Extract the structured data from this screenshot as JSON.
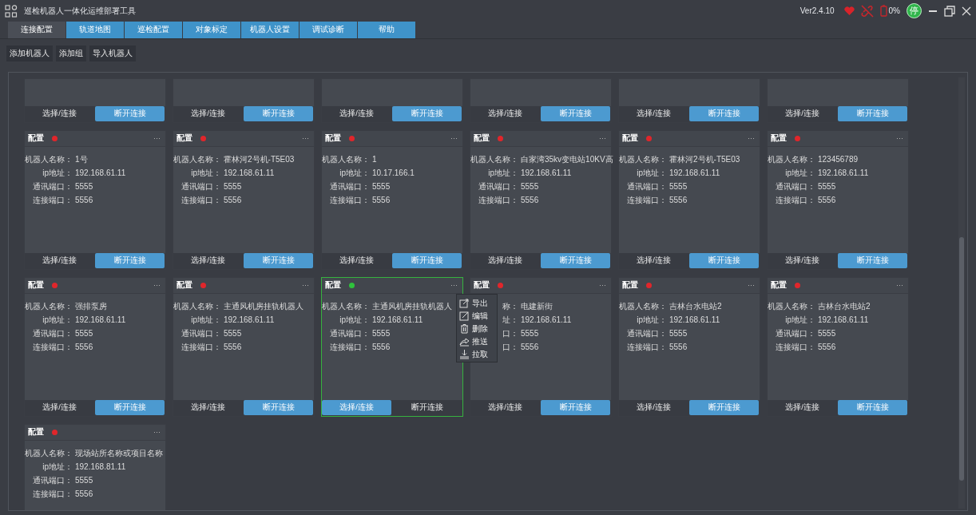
{
  "window": {
    "title": "巡检机器人一体化运维部署工具",
    "version": "Ver2.4.10",
    "battery": "0%",
    "run_state": "停"
  },
  "tabs": [
    {
      "label": "连接配置",
      "selected": true
    },
    {
      "label": "轨道地图",
      "selected": false
    },
    {
      "label": "巡检配置",
      "selected": false
    },
    {
      "label": "对象标定",
      "selected": false
    },
    {
      "label": "机器人设置",
      "selected": false
    },
    {
      "label": "调试诊断",
      "selected": false
    },
    {
      "label": "帮助",
      "selected": false
    }
  ],
  "toolbar": [
    "添加机器人",
    "添加组",
    "导入机器人"
  ],
  "cards": [
    {
      "buttons": [
        "选择/连接",
        "断开连接"
      ],
      "selected": false
    },
    {
      "buttons": [
        "选择/连接",
        "断开连接"
      ],
      "selected": false
    },
    {
      "buttons": [
        "选择/连接",
        "断开连接"
      ],
      "selected": false
    },
    {
      "buttons": [
        "选择/连接",
        "断开连接"
      ],
      "selected": false
    },
    {
      "buttons": [
        "选择/连接",
        "断开连接"
      ],
      "selected": false
    },
    {
      "buttons": [
        "选择/连接",
        "断开连接"
      ],
      "selected": false
    },
    {
      "title": "配置",
      "color": "#e0262b",
      "more": "···",
      "fields": [
        {
          "label": "机器人名称：",
          "value": "1号"
        },
        {
          "label": "ip地址：",
          "value": "192.168.61.11"
        },
        {
          "label": "通讯端口：",
          "value": "5555"
        },
        {
          "label": "连接端口：",
          "value": "5556"
        }
      ],
      "buttons": [
        "选择/连接",
        "断开连接"
      ],
      "selected": false
    },
    {
      "title": "配置",
      "color": "#e0262b",
      "more": "···",
      "fields": [
        {
          "label": "机器人名称：",
          "value": "霍林河2号机-T5E03"
        },
        {
          "label": "ip地址：",
          "value": "192.168.61.11"
        },
        {
          "label": "通讯端口：",
          "value": "5555"
        },
        {
          "label": "连接端口：",
          "value": "5556"
        }
      ],
      "buttons": [
        "选择/连接",
        "断开连接"
      ],
      "selected": false
    },
    {
      "title": "配置",
      "color": "#e0262b",
      "more": "···",
      "fields": [
        {
          "label": "机器人名称：",
          "value": "1"
        },
        {
          "label": "ip地址：",
          "value": "10.17.166.1"
        },
        {
          "label": "通讯端口：",
          "value": "5555"
        },
        {
          "label": "连接端口：",
          "value": "5556"
        }
      ],
      "buttons": [
        "选择/连接",
        "断开连接"
      ],
      "selected": false
    },
    {
      "title": "配置",
      "color": "#e0262b",
      "more": "···",
      "fields": [
        {
          "label": "机器人名称：",
          "value": "白家湾35kv变电站10KV高"
        },
        {
          "label": "ip地址：",
          "value": "192.168.61.11"
        },
        {
          "label": "通讯端口：",
          "value": "5555"
        },
        {
          "label": "连接端口：",
          "value": "5556"
        }
      ],
      "buttons": [
        "选择/连接",
        "断开连接"
      ],
      "selected": false
    },
    {
      "title": "配置",
      "color": "#e0262b",
      "more": "···",
      "fields": [
        {
          "label": "机器人名称：",
          "value": "霍林河2号机-T5E03"
        },
        {
          "label": "ip地址：",
          "value": "192.168.61.11"
        },
        {
          "label": "通讯端口：",
          "value": "5555"
        },
        {
          "label": "连接端口：",
          "value": "5556"
        }
      ],
      "buttons": [
        "选择/连接",
        "断开连接"
      ],
      "selected": false
    },
    {
      "title": "配置",
      "color": "#e0262b",
      "more": "···",
      "fields": [
        {
          "label": "机器人名称：",
          "value": "123456789"
        },
        {
          "label": "ip地址：",
          "value": "192.168.61.11"
        },
        {
          "label": "通讯端口：",
          "value": "5555"
        },
        {
          "label": "连接端口：",
          "value": "5556"
        }
      ],
      "buttons": [
        "选择/连接",
        "断开连接"
      ],
      "selected": false
    },
    {
      "title": "配置",
      "color": "#e0262b",
      "more": "···",
      "fields": [
        {
          "label": "机器人名称：",
          "value": "强排泵房"
        },
        {
          "label": "ip地址：",
          "value": "192.168.61.11"
        },
        {
          "label": "通讯端口：",
          "value": "5555"
        },
        {
          "label": "连接端口：",
          "value": "5556"
        }
      ],
      "buttons": [
        "选择/连接",
        "断开连接"
      ],
      "selected": false
    },
    {
      "title": "配置",
      "color": "#e0262b",
      "more": "···",
      "fields": [
        {
          "label": "机器人名称：",
          "value": "主通风机房挂轨机器人"
        },
        {
          "label": "ip地址：",
          "value": "192.168.61.11"
        },
        {
          "label": "通讯端口：",
          "value": "5555"
        },
        {
          "label": "连接端口：",
          "value": "5556"
        }
      ],
      "buttons": [
        "选择/连接",
        "断开连接"
      ],
      "selected": false
    },
    {
      "title": "配置",
      "color": "#2fc23c",
      "more": "···",
      "fields": [
        {
          "label": "机器人名称：",
          "value": "主通风机房挂轨机器人"
        },
        {
          "label": "ip地址：",
          "value": "192.168.61.11"
        },
        {
          "label": "通讯端口：",
          "value": "5555"
        },
        {
          "label": "连接端口：",
          "value": "5556"
        }
      ],
      "buttons": [
        "选择/连接",
        "断开连接"
      ],
      "selected": true,
      "menu": [
        {
          "kind": "export",
          "label": "导出"
        },
        {
          "kind": "edit",
          "label": "编辑"
        },
        {
          "kind": "delete",
          "label": "删除"
        },
        {
          "kind": "push",
          "label": "推送"
        },
        {
          "kind": "pull",
          "label": "拉取"
        }
      ]
    },
    {
      "title": "配置",
      "color": "#e0262b",
      "more": "···",
      "fields": [
        {
          "label": "称：",
          "value": "电建新街"
        },
        {
          "label": "址：",
          "value": "192.168.61.11"
        },
        {
          "label": "口：",
          "value": "5555"
        },
        {
          "label": "口：",
          "value": "5556"
        }
      ],
      "buttons": [
        "选择/连接",
        "断开连接"
      ],
      "selected": false
    },
    {
      "title": "配置",
      "color": "#e0262b",
      "more": "···",
      "fields": [
        {
          "label": "机器人名称：",
          "value": "吉林台水电站2"
        },
        {
          "label": "ip地址：",
          "value": "192.168.61.11"
        },
        {
          "label": "通讯端口：",
          "value": "5555"
        },
        {
          "label": "连接端口：",
          "value": "5556"
        }
      ],
      "buttons": [
        "选择/连接",
        "断开连接"
      ],
      "selected": false
    },
    {
      "title": "配置",
      "color": "#e0262b",
      "more": "···",
      "fields": [
        {
          "label": "机器人名称：",
          "value": "吉林台水电站2"
        },
        {
          "label": "ip地址：",
          "value": "192.168.61.11"
        },
        {
          "label": "通讯端口：",
          "value": "5555"
        },
        {
          "label": "连接端口：",
          "value": "5556"
        }
      ],
      "buttons": [
        "选择/连接",
        "断开连接"
      ],
      "selected": false
    },
    {
      "title": "配置",
      "color": "#e0262b",
      "more": "···",
      "fields": [
        {
          "label": "机器人名称：",
          "value": "现场站所名称或项目名称"
        },
        {
          "label": "ip地址：",
          "value": "192.168.81.11"
        },
        {
          "label": "通讯端口：",
          "value": "5555"
        },
        {
          "label": "连接端口：",
          "value": "5556"
        }
      ],
      "selected": false
    }
  ]
}
